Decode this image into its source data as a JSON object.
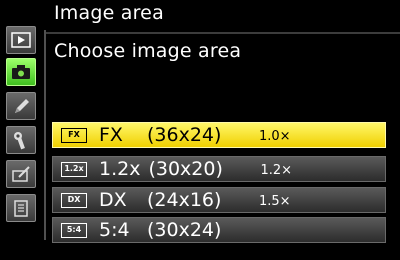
{
  "header": {
    "menu_title": "Image area",
    "subtitle": "Choose image area"
  },
  "sidebar": {
    "tabs": [
      {
        "name": "playback-menu",
        "icon": "playback-icon",
        "active": false
      },
      {
        "name": "shooting-menu",
        "icon": "camera-icon",
        "active": true
      },
      {
        "name": "custom-settings-menu",
        "icon": "pencil-icon",
        "active": false
      },
      {
        "name": "setup-menu",
        "icon": "wrench-icon",
        "active": false
      },
      {
        "name": "retouch-menu",
        "icon": "retouch-icon",
        "active": false
      },
      {
        "name": "my-menu",
        "icon": "my-menu-icon",
        "active": false
      }
    ]
  },
  "options": [
    {
      "icon_label": "FX",
      "format": "FX",
      "dimensions": "(36x24)",
      "crop_factor": "1.0×",
      "selected": true
    },
    {
      "icon_label": "1.2x",
      "format": "1.2x",
      "dimensions": "(30x20)",
      "crop_factor": "1.2×",
      "selected": false
    },
    {
      "icon_label": "DX",
      "format": "DX",
      "dimensions": "(24x16)",
      "crop_factor": "1.5×",
      "selected": false
    },
    {
      "icon_label": "5:4",
      "format": "5:4",
      "dimensions": "(30x24)",
      "crop_factor": "",
      "selected": false
    }
  ],
  "colors": {
    "background": "#000000",
    "highlight": "#f8e41a",
    "active_tab": "#5fd33a",
    "row": "#3e3e3e"
  }
}
